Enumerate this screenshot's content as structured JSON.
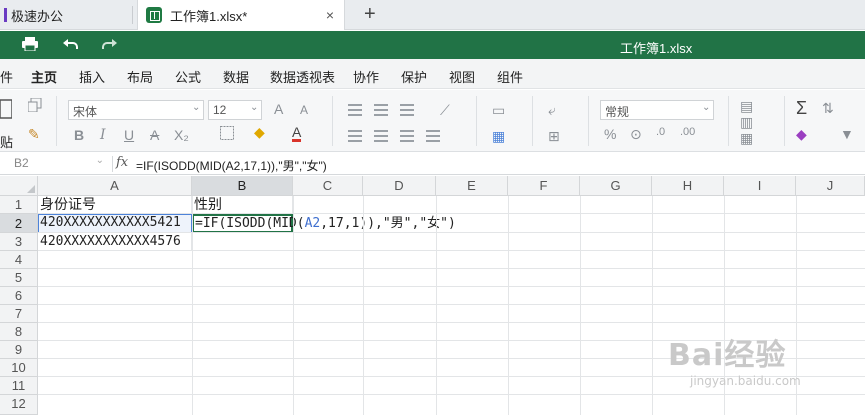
{
  "browser": {
    "tabs": [
      {
        "label": "极速办公",
        "active": false
      },
      {
        "label": "工作簿1.xlsx*",
        "active": true
      }
    ],
    "new_tab": "+",
    "close": "×"
  },
  "titlebar": {
    "doc_title": "工作簿1.xlsx",
    "color": "#217346"
  },
  "menu": {
    "items": [
      "件",
      "主页",
      "插入",
      "布局",
      "公式",
      "数据",
      "数据透视表",
      "协作",
      "保护",
      "视图",
      "组件"
    ],
    "active": "主页"
  },
  "ribbon": {
    "paste_label": "贴",
    "font_name": "宋体",
    "font_size": "12",
    "number_format": "常规",
    "bold": "B",
    "italic": "I",
    "underline": "U",
    "strike": "A",
    "subscript": "X₂",
    "font_color": "A",
    "grow_font": "A",
    "shrink_font": "A",
    "percent": "%",
    "sum": "Σ"
  },
  "formula_bar": {
    "name_box": "B2",
    "fx": "fx",
    "formula": "=IF(ISODD(MID(A2,17,1)),\"男\",\"女\")"
  },
  "grid": {
    "columns": [
      "A",
      "B",
      "C",
      "D",
      "E",
      "F",
      "G",
      "H",
      "I",
      "J"
    ],
    "rows": [
      "1",
      "2",
      "3",
      "4",
      "5",
      "6",
      "7",
      "8",
      "9",
      "10",
      "11",
      "12"
    ],
    "cells": {
      "A1": "身份证号",
      "B1": "性别",
      "A2": "420XXXXXXXXXXX5421",
      "A3": "420XXXXXXXXXXX4576"
    },
    "edit": {
      "prefix": "=IF(ISODD(MID(",
      "ref": "A2",
      "suffix": ",17,1)),\"男\",\"女\")"
    }
  },
  "watermark": {
    "brand": "Bai经验",
    "url": "jingyan.baidu.com"
  }
}
